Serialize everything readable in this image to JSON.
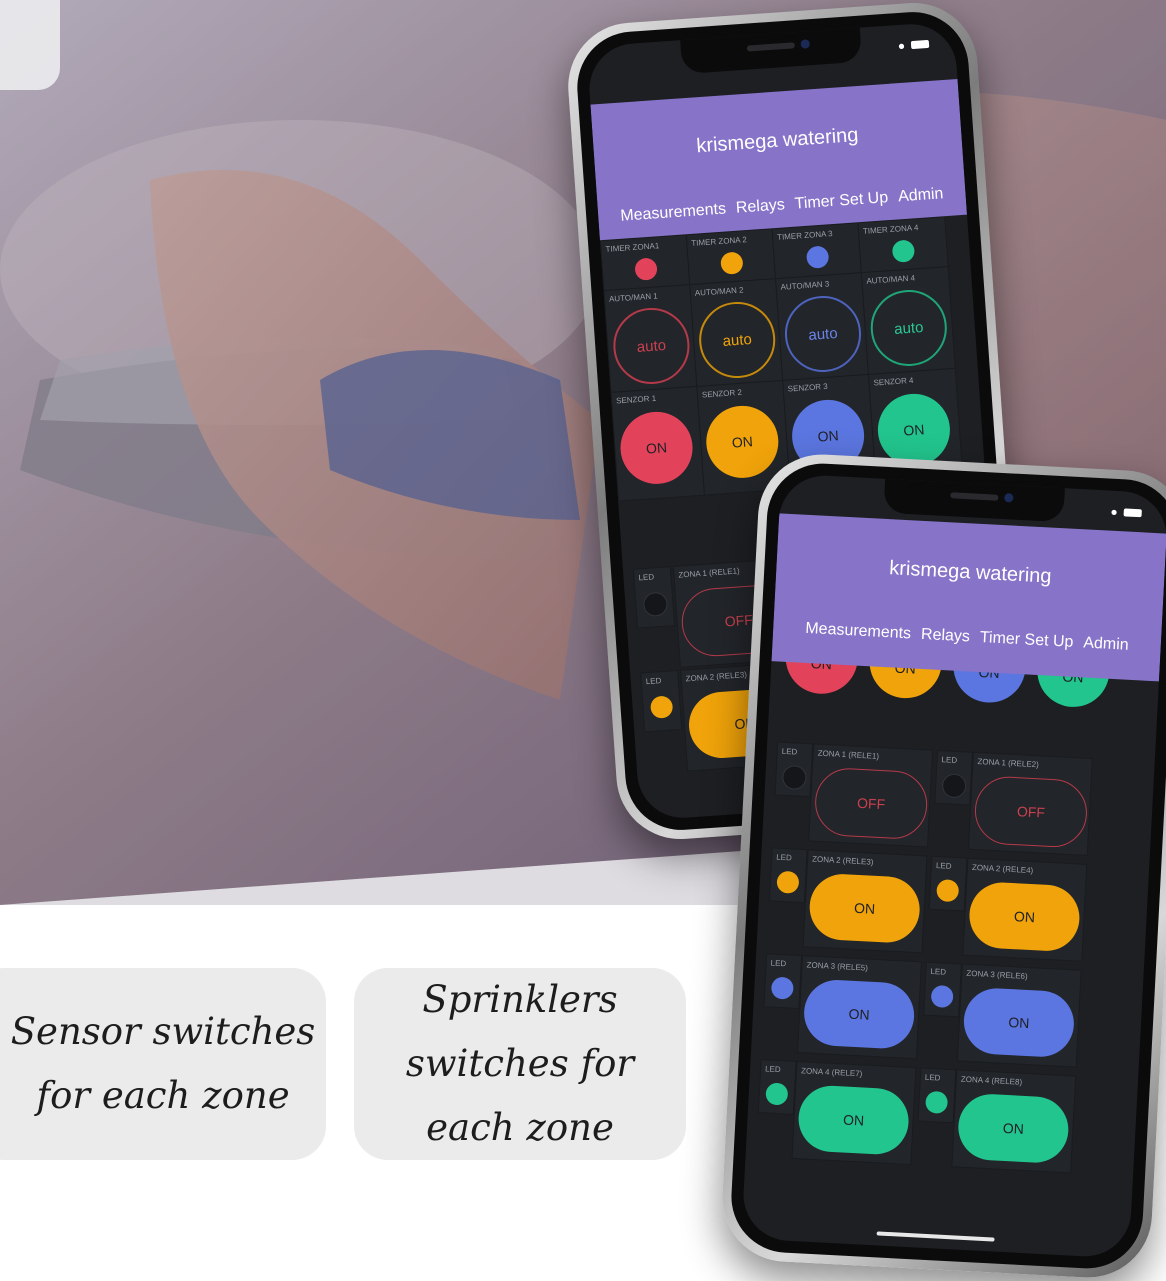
{
  "colors": {
    "accent": "#8774c9",
    "red": "#e3435a",
    "orange": "#f0a30a",
    "blue": "#5b76e0",
    "green": "#22c58d",
    "screen": "#1d1f23"
  },
  "captions": {
    "sensor": "Sensor switches for each zone",
    "sprinklers": "Sprinklers switches for each zone"
  },
  "app": {
    "title": "krismega watering",
    "nav": [
      "Measurements",
      "Relays",
      "Timer Set Up",
      "Admin"
    ]
  },
  "phone1": {
    "timers": [
      "TIMER ZONA1",
      "TIMER ZONA 2",
      "TIMER ZONA 3",
      "TIMER ZONA 4"
    ],
    "automan": [
      "AUTO/MAN 1",
      "AUTO/MAN 2",
      "AUTO/MAN 3",
      "AUTO/MAN 4"
    ],
    "auto_label": "auto",
    "sensors": [
      "SENZOR 1",
      "SENZOR 2",
      "SENZOR 3",
      "SENZOR 4"
    ],
    "sensor_state": "ON",
    "led": "LED",
    "relay1": "ZONA 1 (RELE1)",
    "relay1_state": "OFF",
    "relay3": "ZONA 2 (RELE3)",
    "relay3_state": "ON"
  },
  "phone2": {
    "top_state": "ON",
    "led": "LED",
    "relays": [
      {
        "name": "ZONA 1 (RELE1)",
        "state": "OFF"
      },
      {
        "name": "ZONA 1 (RELE2)",
        "state": "OFF"
      },
      {
        "name": "ZONA 2 (RELE3)",
        "state": "ON"
      },
      {
        "name": "ZONA 2 (RELE4)",
        "state": "ON"
      },
      {
        "name": "ZONA 3 (RELE5)",
        "state": "ON"
      },
      {
        "name": "ZONA 3 (RELE6)",
        "state": "ON"
      },
      {
        "name": "ZONA 4 (RELE7)",
        "state": "ON"
      },
      {
        "name": "ZONA 4 (RELE8)",
        "state": "ON"
      }
    ]
  }
}
